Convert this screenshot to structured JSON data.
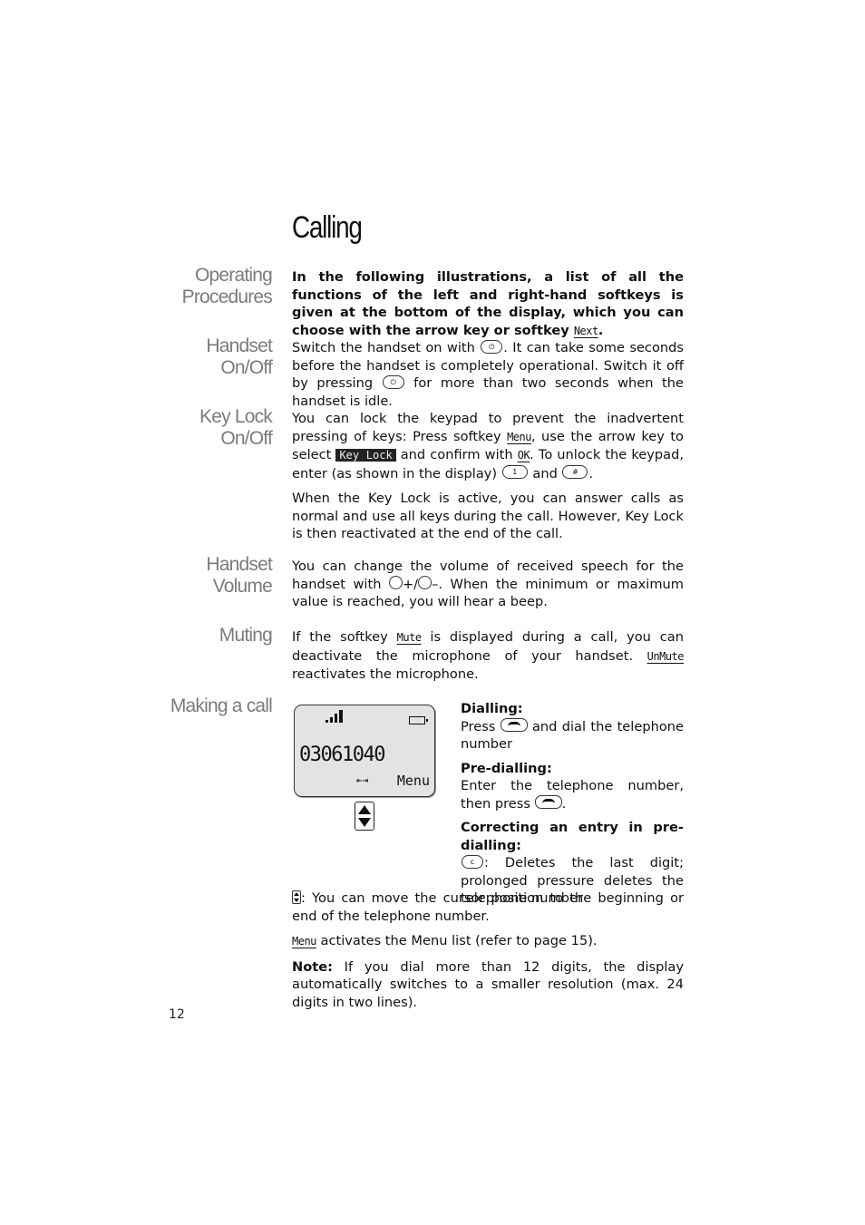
{
  "page": {
    "title": "Calling",
    "page_number": "12"
  },
  "side_headings": {
    "operating_procedures": [
      "Operating",
      "Procedures"
    ],
    "handset_on_off": [
      "Handset",
      "On/Off"
    ],
    "key_lock_on_off": [
      "Key Lock",
      "On/Off"
    ],
    "handset_volume": [
      "Handset",
      "Volume"
    ],
    "muting": "Muting",
    "making_a_call": "Making a call"
  },
  "intro": {
    "text_before": "In the following illustrations, a list of all the functions of the left and right-hand softkeys is given at the bottom of the display, which you can choose with the arrow key or softkey ",
    "softkey": "Next",
    "text_after": "."
  },
  "handset_on_off": {
    "t1": "Switch the handset on with ",
    "t2": ". It can take some seconds before the handset is completely operational. Switch it off by pressing ",
    "t3": " for more than two seconds when the handset is idle.",
    "power_icon": "⏻"
  },
  "key_lock": {
    "p1_t1": "You can lock the keypad to prevent the inadvertent pressing of keys: Press softkey ",
    "p1_menu": "Menu",
    "p1_t2": ", use the arrow key to select ",
    "p1_keylock": "Key Lock",
    "p1_t3": " and confirm with ",
    "p1_ok": "OK",
    "p1_t4": ". To unlock the keypad, enter (as shown in the display) ",
    "key_1": "1",
    "p1_and": " and ",
    "key_hash": "#",
    "p1_t5": ".",
    "p2": "When the Key Lock is active, you can answer calls as normal and use all keys during the call. However, Key Lock is then reactivated at the end of the call."
  },
  "volume": {
    "t1": "You can change the volume of received speech for the handset with ",
    "plus": "+/",
    "minus": "–",
    "t2": ". When the minimum or maximum value is reached, you will hear a beep."
  },
  "muting": {
    "t1": "If the softkey ",
    "mute": "Mute",
    "t2": " is displayed during a call, you can deactivate the microphone of your handset. ",
    "unmute": "UnMute",
    "t3": " reactivates the microphone."
  },
  "phone_display": {
    "number": "03061040",
    "cursor_symbol": "⇤⇥",
    "softkey": "Menu",
    "signal_icon": "signal-strength",
    "battery_icon": "battery"
  },
  "making_call": {
    "dialling_heading": "Dialling:",
    "dialling_t1": "Press ",
    "dialling_t2": " and dial the telephone number",
    "predialling_heading": "Pre-dialling:",
    "predialling_t1": "Enter the telephone number, then press ",
    "predialling_t2": ".",
    "correcting_heading": "Correcting an entry in pre-dialling:",
    "c_key": "c",
    "correcting_text": ": Deletes the last digit; prolonged pressure deletes the telephone number",
    "cursor_text": ": You can move the cursor position to the beginning or end of the telephone number.",
    "menu_softkey": "Menu",
    "menu_text": " activates the Menu list (refer to page 15).",
    "note_label": "Note:",
    "note_text": " If you dial more than 12 digits, the display automatically switches to a smaller resolution (max. 24 digits in two lines)."
  }
}
